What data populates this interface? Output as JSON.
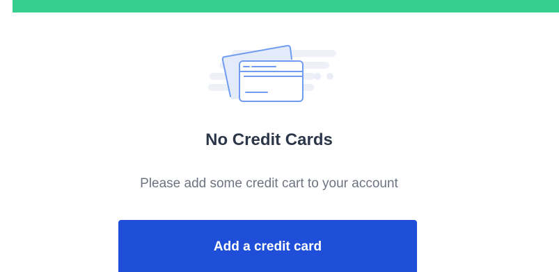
{
  "empty_state": {
    "illustration": "credit-cards-icon",
    "title": "No Credit Cards",
    "message": "Please add some credit cart to your account",
    "button_label": "Add a credit card"
  },
  "colors": {
    "accent_bar": "#34ce8f",
    "button": "#1f4fd9",
    "title": "#2b3648",
    "message": "#6d7380",
    "illustration_stroke": "#6f9bf0"
  }
}
